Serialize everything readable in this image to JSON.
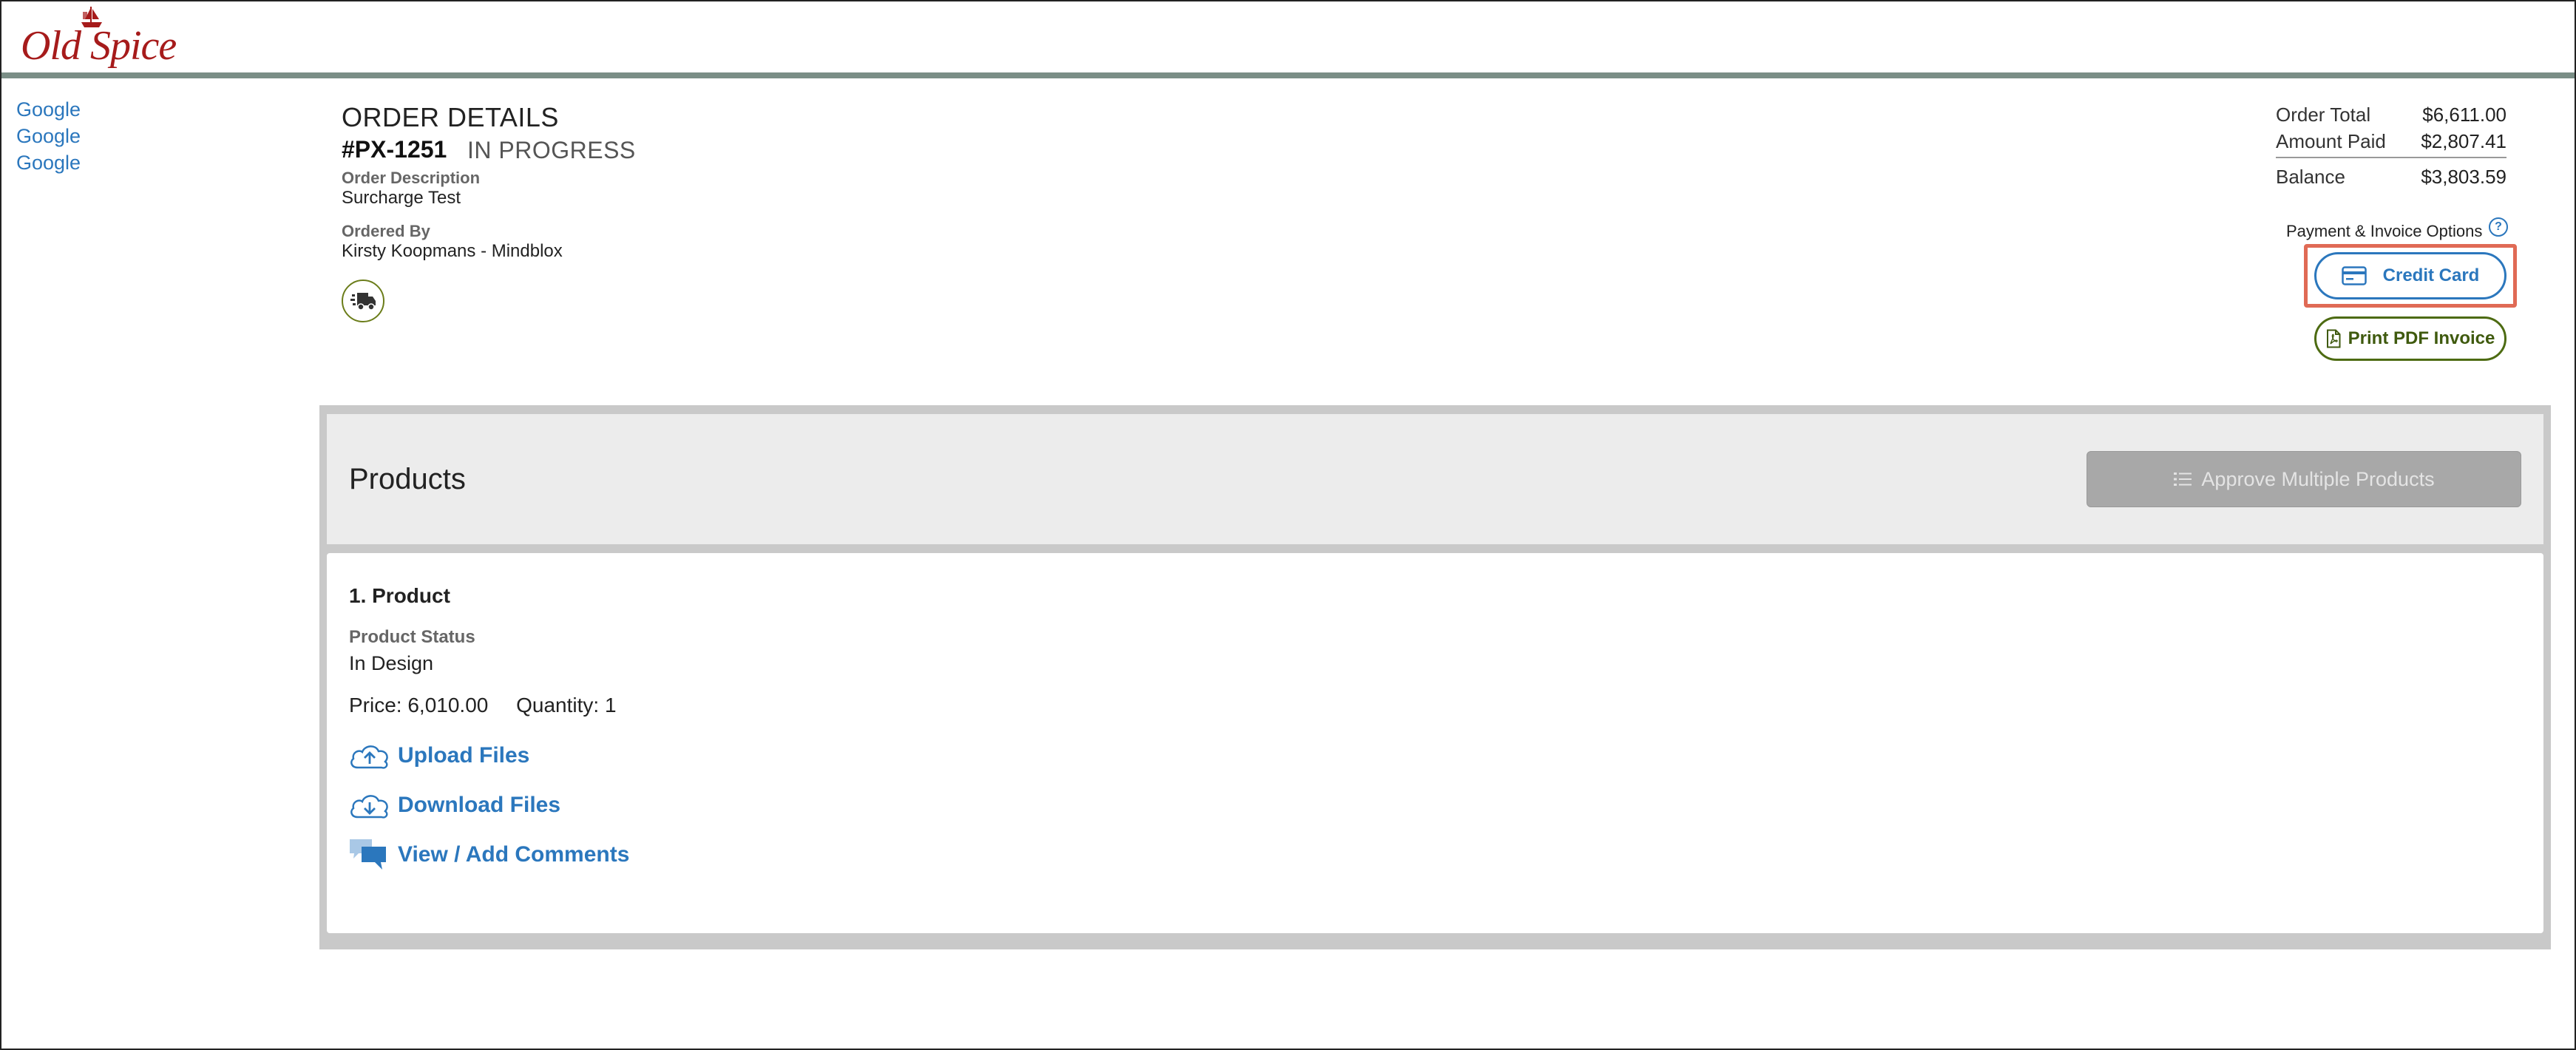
{
  "brand": {
    "logo_text": "Old Spice",
    "color": "#a61b1b"
  },
  "sidebar": {
    "links": [
      "Google",
      "Google",
      "Google"
    ]
  },
  "order": {
    "title": "ORDER DETAILS",
    "number": "#PX-1251",
    "status": "IN PROGRESS",
    "description_label": "Order Description",
    "description": "Surcharge Test",
    "ordered_by_label": "Ordered By",
    "ordered_by": "Kirsty Koopmans - Mindblox",
    "shipping_icon": "truck-icon"
  },
  "totals": {
    "order_total_label": "Order Total",
    "order_total": "$6,611.00",
    "amount_paid_label": "Amount Paid",
    "amount_paid": "$2,807.41",
    "balance_label": "Balance",
    "balance": "$3,803.59"
  },
  "payment": {
    "label": "Payment & Invoice Options",
    "help_icon": "?",
    "credit_card_label": "Credit Card",
    "print_pdf_label": "Print PDF Invoice"
  },
  "products": {
    "title": "Products",
    "approve_label": "Approve Multiple Products",
    "items": [
      {
        "title": "1.  Product",
        "status_label": "Product Status",
        "status": "In Design",
        "price": "Price: 6,010.00",
        "quantity": "Quantity: 1",
        "upload_label": "Upload Files",
        "download_label": "Download Files",
        "comments_label": "View / Add Comments"
      }
    ]
  },
  "colors": {
    "link": "#2b77bd",
    "pdf_button": "#4d6b12",
    "highlight": "#e06a55",
    "header_rule": "#7a8e86"
  }
}
